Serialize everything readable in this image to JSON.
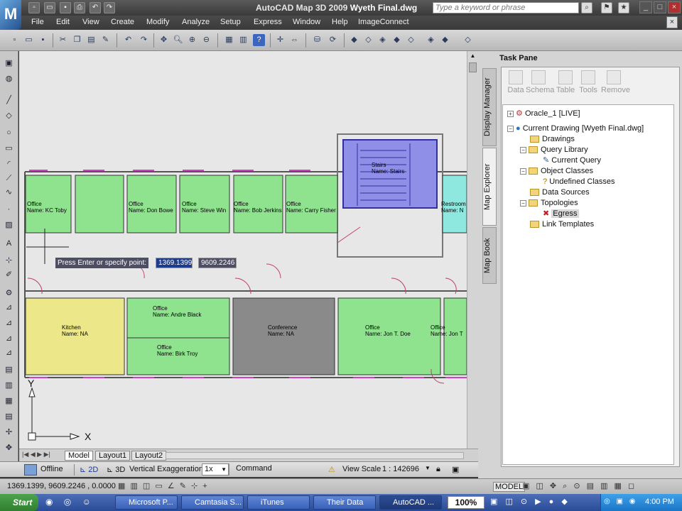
{
  "window": {
    "app_name": "AutoCAD Map 3D 2009",
    "document": "Wyeth Final.dwg",
    "logo_letter": "M",
    "search_placeholder": "Type a keyword or phrase"
  },
  "menu": [
    "File",
    "Edit",
    "View",
    "Create",
    "Modify",
    "Analyze",
    "Setup",
    "Express",
    "Window",
    "Help",
    "ImageConnect"
  ],
  "drawing": {
    "rooms": [
      {
        "line1": "Office",
        "line2": "Name: KC Toby"
      },
      {
        "line1": "Office",
        "line2": "Name: Don Bowe"
      },
      {
        "line1": "Office",
        "line2": "Name: Steve Win"
      },
      {
        "line1": "Office",
        "line2": "Name: Bob Jerkins"
      },
      {
        "line1": "Office",
        "line2": "Name: Carry Fisher"
      },
      {
        "line1": "Stairs",
        "line2": "Name: Stairs"
      },
      {
        "line1": "Restroom",
        "line2": "Name: N"
      },
      {
        "line1": "Kitchen",
        "line2": "Name: NA"
      },
      {
        "line1": "Office",
        "line2": "Name: Andre Black"
      },
      {
        "line1": "Office",
        "line2": "Name: Birk Troy"
      },
      {
        "line1": "Conference",
        "line2": "Name: NA"
      },
      {
        "line1": "Office",
        "line2": "Name: Jon T. Doe"
      },
      {
        "line1": "Office",
        "line2": "Name: Jon T"
      }
    ],
    "prompt": "Press Enter or specify point:",
    "coord_x": "1369.1399",
    "coord_y": "9609.2246",
    "ucs_x": "X",
    "ucs_y": "Y"
  },
  "layout_tabs": [
    "Model",
    "Layout1",
    "Layout2"
  ],
  "status": {
    "offline": "Offline",
    "mode_2d": "2D",
    "mode_3d": "3D",
    "vert_exag_label": "Vertical Exaggeration:",
    "vert_exag_value": "1x",
    "command": "Command",
    "view_scale_label": "View Scale",
    "view_scale_value": "1 : 142696"
  },
  "coordbar": {
    "coords": "1369.1399, 9609.2246 , 0.0000",
    "model": "MODEL"
  },
  "task_pane": {
    "title": "Task Pane",
    "vertical_tabs": [
      "Display Manager",
      "Map Explorer",
      "Map Book"
    ],
    "tools": [
      "Data",
      "Schema",
      "Table",
      "Tools",
      "Remove"
    ],
    "tree": [
      {
        "label": "Oracle_1 [LIVE]",
        "level": 0,
        "icon": "database-icon"
      },
      {
        "label": "Current Drawing [Wyeth Final.dwg]",
        "level": 0,
        "icon": "globe-icon"
      },
      {
        "label": "Drawings",
        "level": 1,
        "icon": "folder-icon"
      },
      {
        "label": "Query Library",
        "level": 1,
        "icon": "folder-icon"
      },
      {
        "label": "Current Query",
        "level": 2,
        "icon": "query-icon"
      },
      {
        "label": "Object Classes",
        "level": 1,
        "icon": "folder-icon"
      },
      {
        "label": "Undefined Classes",
        "level": 2,
        "icon": "question-icon"
      },
      {
        "label": "Data Sources",
        "level": 1,
        "icon": "folder-icon"
      },
      {
        "label": "Topologies",
        "level": 1,
        "icon": "folder-icon"
      },
      {
        "label": "Egress",
        "level": 2,
        "icon": "topology-icon"
      },
      {
        "label": "Link Templates",
        "level": 1,
        "icon": "folder-icon"
      }
    ]
  },
  "taskbar": {
    "start": "Start",
    "buttons": [
      "Microsoft P...",
      "Camtasia S...",
      "iTunes",
      "Their Data",
      "AutoCAD ..."
    ],
    "zoom": "100%",
    "clock": "4:00 PM"
  }
}
